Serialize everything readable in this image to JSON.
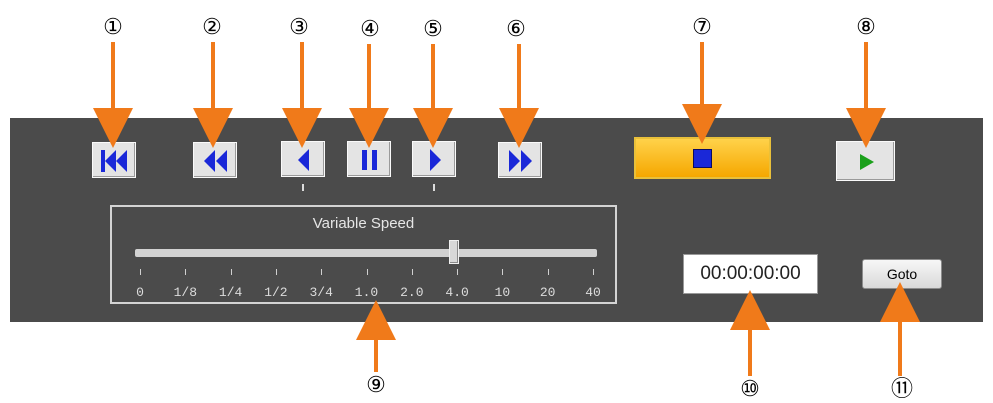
{
  "callouts": [
    "①",
    "②",
    "③",
    "④",
    "⑤",
    "⑥",
    "⑦",
    "⑧",
    "⑨",
    "⑩",
    "⑪"
  ],
  "toolbar": {
    "buttons": [
      {
        "name": "skip-to-start",
        "icon": "skip-to-start-icon"
      },
      {
        "name": "rewind",
        "icon": "rewind-icon"
      },
      {
        "name": "step-back",
        "icon": "step-back-icon"
      },
      {
        "name": "pause",
        "icon": "pause-icon"
      },
      {
        "name": "step-forward",
        "icon": "step-forward-icon"
      },
      {
        "name": "fast-forward",
        "icon": "fast-forward-icon"
      },
      {
        "name": "stop",
        "icon": "stop-icon"
      },
      {
        "name": "play",
        "icon": "play-icon"
      }
    ]
  },
  "speed": {
    "title": "Variable Speed",
    "labels": [
      "0",
      "1/8",
      "1/4",
      "1/2",
      "3/4",
      "1.0",
      "2.0",
      "4.0",
      "10",
      "20",
      "40"
    ],
    "selected": "4.0"
  },
  "timecode": {
    "value": "00:00:00:00"
  },
  "goto": {
    "label": "Goto"
  },
  "colors": {
    "panel": "#4b4b4b",
    "arrow": "#f07a1a",
    "icon_blue": "#1a28d8",
    "play_green": "#1aa01a",
    "stop_bg": "#f5a700"
  }
}
